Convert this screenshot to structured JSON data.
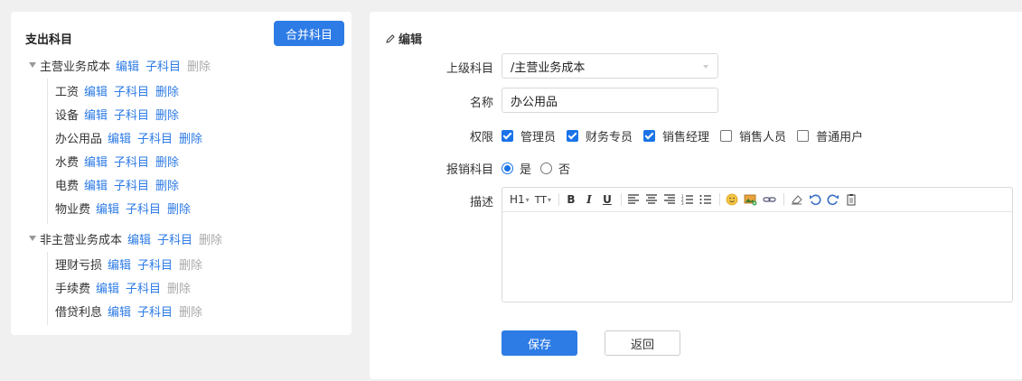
{
  "left": {
    "title": "支出科目",
    "merge_button": "合并科目",
    "action_edit": "编辑",
    "action_child": "子科目",
    "action_delete": "删除",
    "groups": [
      {
        "label": "主营业务成本",
        "delete_enabled": false,
        "children": [
          {
            "label": "工资",
            "delete_enabled": true
          },
          {
            "label": "设备",
            "delete_enabled": true
          },
          {
            "label": "办公用品",
            "delete_enabled": true
          },
          {
            "label": "水费",
            "delete_enabled": true
          },
          {
            "label": "电费",
            "delete_enabled": true
          },
          {
            "label": "物业费",
            "delete_enabled": true
          }
        ]
      },
      {
        "label": "非主营业务成本",
        "delete_enabled": false,
        "children": [
          {
            "label": "理财亏损",
            "delete_enabled": false
          },
          {
            "label": "手续费",
            "delete_enabled": false
          },
          {
            "label": "借贷利息",
            "delete_enabled": false
          }
        ]
      }
    ]
  },
  "right": {
    "title": "编辑",
    "parent_label": "上级科目",
    "parent_value": "/主营业务成本",
    "name_label": "名称",
    "name_value": "办公用品",
    "perm_label": "权限",
    "permissions": [
      {
        "label": "管理员",
        "checked": true
      },
      {
        "label": "财务专员",
        "checked": true
      },
      {
        "label": "销售经理",
        "checked": true
      },
      {
        "label": "销售人员",
        "checked": false
      },
      {
        "label": "普通用户",
        "checked": false
      }
    ],
    "reimburse_label": "报销科目",
    "reimburse_yes": "是",
    "reimburse_no": "否",
    "reimburse_value": "是",
    "desc_label": "描述",
    "toolbar": {
      "heading": "H1",
      "fontsize": "TT",
      "bold": "B",
      "italic": "I",
      "underline": "U"
    },
    "save_button": "保存",
    "back_button": "返回"
  },
  "colors": {
    "primary": "#2d7be5",
    "disabled_link": "#aaaaaa",
    "checkbox_on": "#1a73e8"
  }
}
